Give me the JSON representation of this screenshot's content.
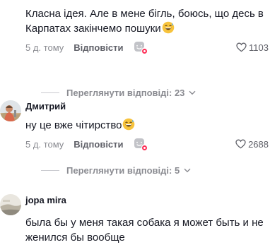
{
  "comments": [
    {
      "username": "",
      "text": "Класна ідея. Але в мене бігль, боюсь, що десь в Карпатах закінчемо пошуки",
      "emoji": "grinning-sweat-emoji",
      "date": "5 д. тому",
      "reply_label": "Відповісти",
      "likes": "1103",
      "view_replies": "Переглянути відповіді: 23"
    },
    {
      "username": "Дмитрий",
      "text": "ну це вже чітирство",
      "emoji": "grinning-sweat-emoji",
      "date": "5 д. тому",
      "reply_label": "Відповісти",
      "likes": "2688",
      "view_replies": "Переглянути відповіді: 5"
    },
    {
      "username": "jopa mira",
      "text": "была бы у меня такая собака я может быть и не женился бы вообще"
    }
  ],
  "colors": {
    "text": "#161823",
    "secondary": "#8a8b91",
    "reply": "#5f6068",
    "accent": "#fe2c55"
  }
}
